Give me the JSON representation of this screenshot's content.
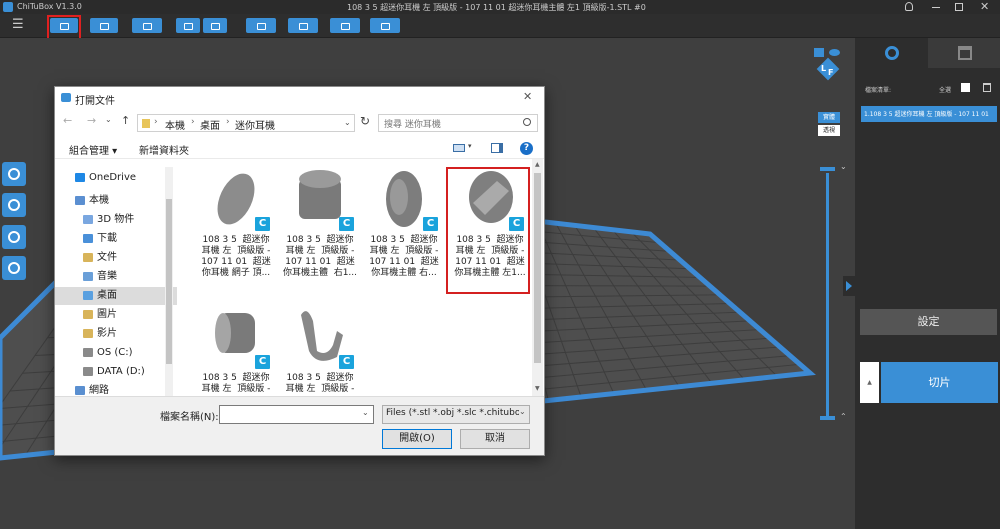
{
  "app": {
    "title": "ChiTuBox V1.3.0",
    "window_title": "108 3 5  超迷你耳機 左  頂級版 - 107 11 01  超迷你耳機主體 左1 頂級版-1.STL #0"
  },
  "toolbar": {
    "menu_icon": "☰"
  },
  "right_panel": {
    "tab1_icon": "gear-icon",
    "tab2_icon": "support-icon",
    "file_list_label": "檔案清單:",
    "select_all_label": "全選",
    "file_item": "1.108 3 5  超迷你耳機 左  頂級版 - 107 11 01",
    "view_solid": "實體",
    "view_transparent": "透視",
    "settings_button": "設定",
    "slice_button": "切片",
    "slider_up": "▲"
  },
  "view_cube": {
    "letters": [
      "L",
      "F"
    ]
  },
  "dialog": {
    "title": "打開文件",
    "breadcrumb": [
      "本機",
      "桌面",
      "迷你耳機"
    ],
    "search_placeholder": "搜尋 迷你耳機",
    "organize": "組合管理 ▾",
    "new_folder": "新增資料夾",
    "help": "?",
    "nav_items": [
      {
        "label": "OneDrive",
        "color": "#1e88e5"
      },
      {
        "label": "本機",
        "color": "#5b8fd1"
      },
      {
        "label": "3D 物件",
        "color": "#7aa7e0"
      },
      {
        "label": "下載",
        "color": "#4a90d9"
      },
      {
        "label": "文件",
        "color": "#d8b45a"
      },
      {
        "label": "音樂",
        "color": "#6a9fd8"
      },
      {
        "label": "桌面",
        "color": "#5aa0e0"
      },
      {
        "label": "圖片",
        "color": "#d8b45a"
      },
      {
        "label": "影片",
        "color": "#d8b45a"
      },
      {
        "label": "OS (C:)",
        "color": "#8a8a8a"
      },
      {
        "label": "DATA (D:)",
        "color": "#8a8a8a"
      },
      {
        "label": "網路",
        "color": "#5a8fd0"
      }
    ],
    "files": [
      {
        "label": "108 3 5  超迷你\n耳機 左  頂級版 -\n107 11 01  超迷\n你耳機 網子 頂..."
      },
      {
        "label": "108 3 5  超迷你\n耳機 左  頂級版 -\n107 11 01  超迷\n你耳機主體  右1..."
      },
      {
        "label": "108 3 5  超迷你\n耳機 左  頂級版 -\n107 11 01  超迷\n你耳機主體 右..."
      },
      {
        "label": "108 3 5  超迷你\n耳機 左  頂級版 -\n107 11 01  超迷\n你耳機主體 左1..."
      },
      {
        "label": "108 3 5  超迷你\n耳機 左  頂級版 -"
      },
      {
        "label": "108 3 5  超迷你\n耳機 左  頂級版 -"
      }
    ],
    "filename_label": "檔案名稱(N):",
    "filename_value": "",
    "filetype": "Files (*.stl *.obj *.slc *.chitubox",
    "open_button": "開啟(O)",
    "cancel_button": "取消"
  }
}
